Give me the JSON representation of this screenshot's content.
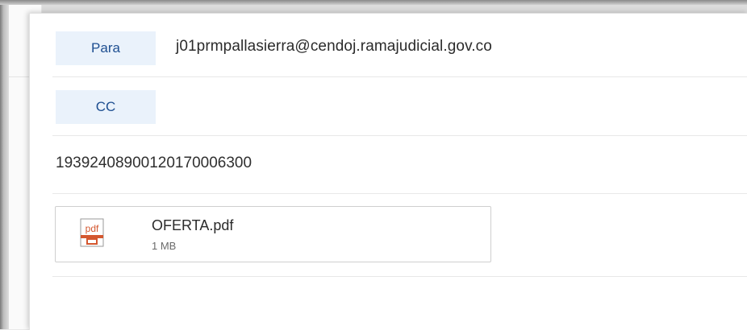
{
  "message": {
    "to_label": "Para",
    "to_address": "j01prmpallasierra@cendoj.ramajudicial.gov.co",
    "cc_label": "CC",
    "subject": "19392408900120170006300"
  },
  "attachment": {
    "icon": "pdf-file-icon",
    "icon_text": "pdf",
    "file_name": "OFERTA.pdf",
    "file_size": "1 MB"
  },
  "colors": {
    "chip_bg": "#eaf2fb",
    "chip_text": "#1e4f91",
    "pdf_accent": "#d4572f"
  }
}
